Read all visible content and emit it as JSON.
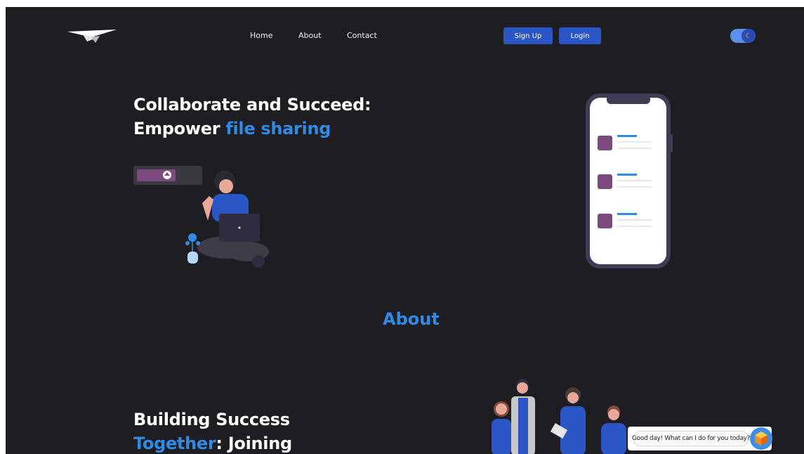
{
  "nav": {
    "links": [
      "Home",
      "About",
      "Contact"
    ],
    "signup_label": "Sign Up",
    "login_label": "Login",
    "theme_toggle_icon": "moon-icon"
  },
  "hero": {
    "title_line1": "Collaborate and Succeed:",
    "title_line2_plain": "Empower",
    "title_line2_accent": "file sharing"
  },
  "about": {
    "heading": "About",
    "title_line1": "Building Success",
    "title_line2_accent": "Together",
    "title_line2_plain": ": Joining"
  },
  "chat": {
    "greeting": "Good day! What can I do for you today?",
    "avatar_icon": "cube-icon"
  },
  "colors": {
    "background": "#1e1d21",
    "accent": "#2f8be6",
    "button": "#2b56c5",
    "card_purple": "#7d4a80"
  }
}
